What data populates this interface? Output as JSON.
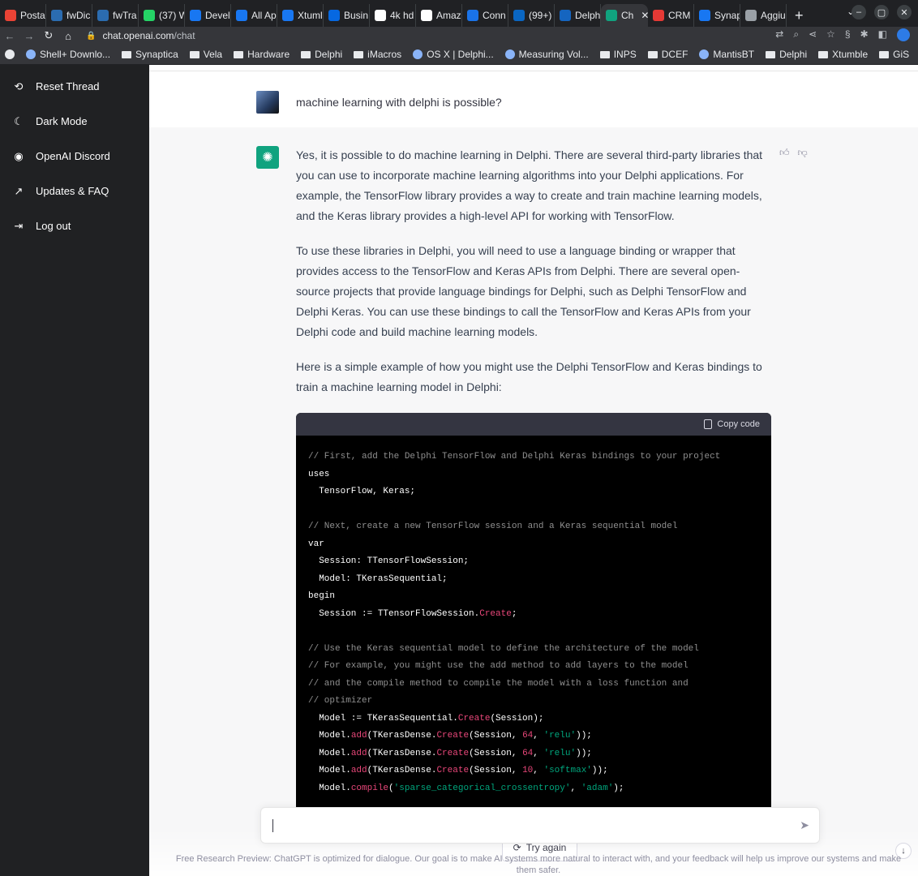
{
  "browser": {
    "tabs": [
      {
        "label": "Posta",
        "color": "#ea4335"
      },
      {
        "label": "fwDic",
        "color": "#2b6cb0"
      },
      {
        "label": "fwTra",
        "color": "#2b6cb0"
      },
      {
        "label": "(37) W",
        "color": "#25d366"
      },
      {
        "label": "Devel",
        "color": "#1877f2"
      },
      {
        "label": "All Ap",
        "color": "#1877f2"
      },
      {
        "label": "Xtuml",
        "color": "#1877f2"
      },
      {
        "label": "Busin",
        "color": "#0668e1"
      },
      {
        "label": "4k hd",
        "color": "#ffffff"
      },
      {
        "label": "Amaz",
        "color": "#ffffff"
      },
      {
        "label": "Conn",
        "color": "#1a73e8"
      },
      {
        "label": "(99+)",
        "color": "#0a66c2"
      },
      {
        "label": "Delph",
        "color": "#1565c0"
      },
      {
        "label": "Ch",
        "color": "#10a37f",
        "active": true
      },
      {
        "label": "CRM",
        "color": "#e53935"
      },
      {
        "label": "Synap",
        "color": "#1877f2"
      },
      {
        "label": "Aggiu",
        "color": "#9aa0a6"
      }
    ],
    "url_host": "chat.openai.com",
    "url_path": "/chat",
    "bookmarks": [
      {
        "label": "Shell+ Downlo...",
        "icon": "site"
      },
      {
        "label": "Synaptica",
        "icon": "folder"
      },
      {
        "label": "Vela",
        "icon": "folder"
      },
      {
        "label": "Hardware",
        "icon": "folder"
      },
      {
        "label": "Delphi",
        "icon": "folder"
      },
      {
        "label": "iMacros",
        "icon": "folder"
      },
      {
        "label": "OS X | Delphi...",
        "icon": "site"
      },
      {
        "label": "Measuring Vol...",
        "icon": "site"
      },
      {
        "label": "INPS",
        "icon": "folder"
      },
      {
        "label": "DCEF",
        "icon": "folder"
      },
      {
        "label": "MantisBT",
        "icon": "site"
      },
      {
        "label": "Delphi",
        "icon": "folder"
      },
      {
        "label": "Xtumble",
        "icon": "folder"
      },
      {
        "label": "GiS",
        "icon": "folder"
      }
    ]
  },
  "sidebar": {
    "items": [
      {
        "label": "Reset Thread",
        "icon": "refresh-icon"
      },
      {
        "label": "Dark Mode",
        "icon": "moon-icon"
      },
      {
        "label": "OpenAI Discord",
        "icon": "discord-icon"
      },
      {
        "label": "Updates & FAQ",
        "icon": "external-link-icon"
      },
      {
        "label": "Log out",
        "icon": "logout-icon"
      }
    ]
  },
  "conversation": {
    "user_message": "machine learning with delphi is possible?",
    "assistant_paragraphs": [
      "Yes, it is possible to do machine learning in Delphi. There are several third-party libraries that you can use to incorporate machine learning algorithms into your Delphi applications. For example, the TensorFlow library provides a way to create and train machine learning models, and the Keras library provides a high-level API for working with TensorFlow.",
      "To use these libraries in Delphi, you will need to use a language binding or wrapper that provides access to the TensorFlow and Keras APIs from Delphi. There are several open-source projects that provide language bindings for Delphi, such as Delphi TensorFlow and Delphi Keras. You can use these bindings to call the TensorFlow and Keras APIs from your Delphi code and build machine learning models.",
      "Here is a simple example of how you might use the Delphi TensorFlow and Keras bindings to train a machine learning model in Delphi:"
    ],
    "copy_code_label": "Copy code",
    "code_lines": [
      "// First, add the Delphi TensorFlow and Delphi Keras bindings to your project",
      "uses",
      "  TensorFlow, Keras;",
      "",
      "// Next, create a new TensorFlow session and a Keras sequential model",
      "var",
      "  Session: TTensorFlowSession;",
      "  Model: TKerasSequential;",
      "begin",
      "  Session := TTensorFlowSession.Create;",
      "",
      "// Use the Keras sequential model to define the architecture of the model",
      "// For example, you might use the add method to add layers to the model",
      "// and the compile method to compile the model with a loss function and",
      "// optimizer",
      "  Model := TKerasSequential.Create(Session);",
      "  Model.add(TKerasDense.Create(Session, 64, 'relu'));",
      "  Model.add(TKerasDense.Create(Session, 64, 'relu'));",
      "  Model.add(TKerasDense.Create(Session, 10, 'softmax'));",
      "  Model.compile('sparse_categorical_crossentropy', 'adam');"
    ],
    "try_again_label": "Try again"
  },
  "composer": {
    "value": "",
    "placeholder": ""
  },
  "footer": {
    "text": "Free Research Preview: ChatGPT is optimized for dialogue. Our goal is to make AI systems more natural to interact with, and your feedback will help us improve our systems and make them safer."
  },
  "colors": {
    "accent": "#10a37f",
    "sidebar_bg": "#202123"
  }
}
